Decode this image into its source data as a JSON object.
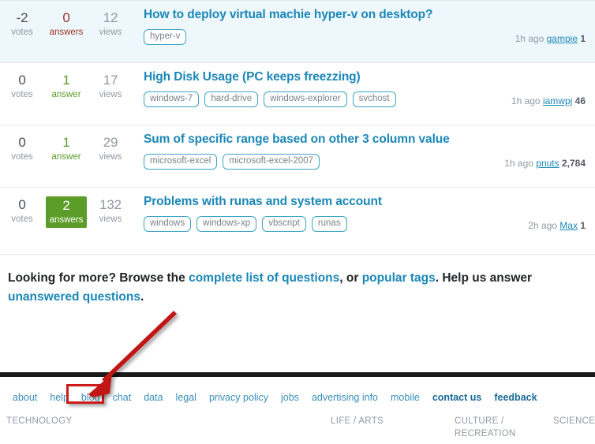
{
  "questions": [
    {
      "votes": "-2",
      "votes_label": "votes",
      "answers": "0",
      "answers_label": "answers",
      "answer_state": "zero",
      "views": "12",
      "views_label": "views",
      "title": "How to deploy virtual machie hyper-v on desktop?",
      "tags": [
        "hyper-v"
      ],
      "time": "1h ago",
      "user": "gampie",
      "rep": "1",
      "highlight": true
    },
    {
      "votes": "0",
      "votes_label": "votes",
      "answers": "1",
      "answers_label": "answer",
      "answer_state": "some",
      "views": "17",
      "views_label": "views",
      "title": "High Disk Usage (PC keeps freezzing)",
      "tags": [
        "windows-7",
        "hard-drive",
        "windows-explorer",
        "svchost"
      ],
      "time": "1h ago",
      "user": "iamwpj",
      "rep": "46",
      "highlight": false
    },
    {
      "votes": "0",
      "votes_label": "votes",
      "answers": "1",
      "answers_label": "answer",
      "answer_state": "some",
      "views": "29",
      "views_label": "views",
      "title": "Sum of specific range based on other 3 column value",
      "tags": [
        "microsoft-excel",
        "microsoft-excel-2007"
      ],
      "time": "1h ago",
      "user": "pnuts",
      "rep": "2,784",
      "highlight": false
    },
    {
      "votes": "0",
      "votes_label": "votes",
      "answers": "2",
      "answers_label": "answers",
      "answer_state": "accepted",
      "views": "132",
      "views_label": "views",
      "title": "Problems with runas and system account",
      "tags": [
        "windows",
        "windows-xp",
        "vbscript",
        "runas"
      ],
      "time": "2h ago",
      "user": "Max",
      "rep": "1",
      "highlight": false
    }
  ],
  "more": {
    "text_1": "Looking for more? Browse the ",
    "link_1": "complete list of questions",
    "text_2": ", or ",
    "link_2": "popular tags",
    "text_3": ". Help us answer ",
    "link_3": "unanswered questions",
    "text_4": "."
  },
  "footer": {
    "links": [
      {
        "label": "about",
        "strong": false
      },
      {
        "label": "help",
        "strong": false
      },
      {
        "label": "blog",
        "strong": false
      },
      {
        "label": "chat",
        "strong": false
      },
      {
        "label": "data",
        "strong": false
      },
      {
        "label": "legal",
        "strong": false
      },
      {
        "label": "privacy policy",
        "strong": false
      },
      {
        "label": "jobs",
        "strong": false
      },
      {
        "label": "advertising info",
        "strong": false
      },
      {
        "label": "mobile",
        "strong": false
      },
      {
        "label": "contact us",
        "strong": true
      },
      {
        "label": "feedback",
        "strong": true
      }
    ],
    "categories": [
      "TECHNOLOGY",
      "LIFE / ARTS",
      "CULTURE / RECREATION",
      "SCIENCE"
    ]
  },
  "annotation": {
    "arrow_color": "#c01818",
    "highlight_box_color": "#cc1b1b",
    "target_label": "blog"
  },
  "colors": {
    "link": "#1b87b7",
    "tag_border": "#3ca4c4",
    "accepted_green": "#5c9c28",
    "answers_red": "#9c3328",
    "row_highlight": "#eef7fb",
    "muted": "#9199a1"
  }
}
